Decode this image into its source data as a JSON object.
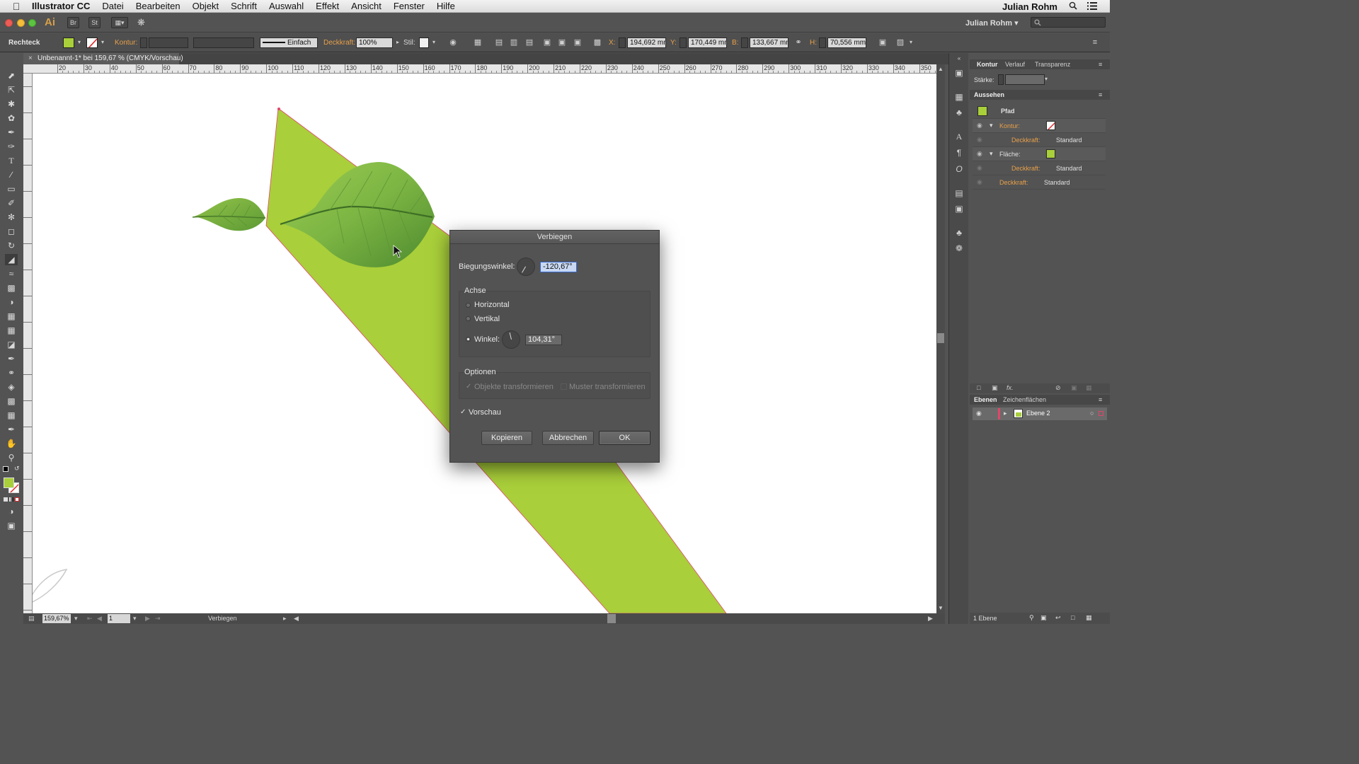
{
  "menubar": {
    "app_name": "Illustrator CC",
    "items": [
      "Datei",
      "Bearbeiten",
      "Objekt",
      "Schrift",
      "Auswahl",
      "Effekt",
      "Ansicht",
      "Fenster",
      "Hilfe"
    ],
    "user": "Julian Rohm"
  },
  "appbar": {
    "logo": "Ai",
    "bridge": "Br",
    "stock": "St",
    "workspace_user": "Julian Rohm"
  },
  "control_bar": {
    "object_type": "Rechteck",
    "stroke_label": "Kontur:",
    "stroke_style": "Einfach",
    "opacity_label": "Deckkraft:",
    "opacity_value": "100%",
    "style_label": "Stil:",
    "x_label": "X:",
    "x_value": "194,692 mm",
    "y_label": "Y:",
    "y_value": "170,449 mm",
    "w_label": "B:",
    "w_value": "133,667 mm",
    "h_label": "H:",
    "h_value": "70,556 mm"
  },
  "document_tab": {
    "title": "Unbenannt-1* bei 159,67 % (CMYK/Vorschau)"
  },
  "ruler_ticks": [
    "20",
    "30",
    "40",
    "50",
    "60",
    "70",
    "80",
    "90",
    "100",
    "110",
    "120",
    "130",
    "140",
    "150",
    "160",
    "170",
    "180",
    "190",
    "200",
    "210",
    "220",
    "230",
    "240",
    "250",
    "260",
    "270",
    "280",
    "290",
    "300",
    "310",
    "320",
    "330",
    "340",
    "350"
  ],
  "status_bar": {
    "zoom": "159,67%",
    "artboard": "1",
    "tool_name": "Verbiegen"
  },
  "dialog": {
    "title": "Verbiegen",
    "bend_label": "Biegungswinkel:",
    "bend_value": "-120,67°",
    "axis_title": "Achse",
    "axis_horizontal": "Horizontal",
    "axis_vertical": "Vertikal",
    "axis_angle_label": "Winkel:",
    "axis_angle_value": "104,31°",
    "options_title": "Optionen",
    "opt_objects": "Objekte transformieren",
    "opt_patterns": "Muster transformieren",
    "preview_label": "Vorschau",
    "btn_copy": "Kopieren",
    "btn_cancel": "Abbrechen",
    "btn_ok": "OK"
  },
  "panels": {
    "stroke_tabs": [
      "Kontur",
      "Verlauf",
      "Transparenz"
    ],
    "stroke_weight_label": "Stärke:",
    "appearance_title": "Aussehen",
    "path_label": "Pfad",
    "appearance_rows": [
      {
        "label": "Kontur:",
        "value": ""
      },
      {
        "label": "Deckkraft:",
        "value": "Standard"
      },
      {
        "label": "Fläche:",
        "value": ""
      },
      {
        "label": "Deckkraft:",
        "value": "Standard"
      },
      {
        "label": "Deckkraft:",
        "value": "Standard"
      }
    ],
    "layers_tabs": [
      "Ebenen",
      "Zeichenflächen"
    ],
    "layer_name": "Ebene 2",
    "layers_count": "1 Ebene"
  },
  "colors": {
    "fill_green": "#a9cf3a",
    "leaf_dark": "#5f9a35",
    "leaf_light": "#8cc24a",
    "accent_orange": "#e8a04a",
    "selection_red": "#e0466a"
  }
}
